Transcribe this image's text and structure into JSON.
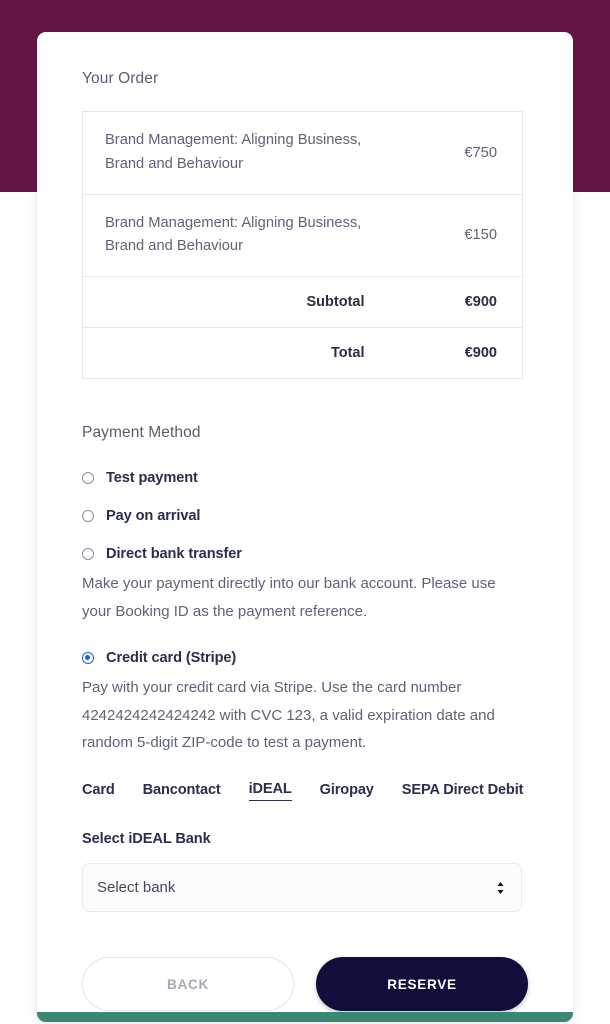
{
  "theme": {
    "page_top_band_color": "#661644",
    "card_accent_bar_color": "#3c8773",
    "selected_radio_color": "#1667cc",
    "primary_button_color": "#100f3c"
  },
  "card": {
    "order": {
      "heading": "Your Order",
      "items": [
        {
          "name": "Brand Management: Aligning Business, Brand and Behaviour",
          "price": "€750"
        },
        {
          "name": "Brand Management: Aligning Business, Brand and Behaviour",
          "price": "€150"
        }
      ],
      "summary": [
        {
          "label": "Subtotal",
          "value": "€900"
        },
        {
          "label": "Total",
          "value": "€900"
        }
      ]
    },
    "payment": {
      "heading": "Payment Method",
      "methods": [
        {
          "label": "Test payment",
          "selected": false,
          "description": null
        },
        {
          "label": "Pay on arrival",
          "selected": false,
          "description": null
        },
        {
          "label": "Direct bank transfer",
          "selected": false,
          "description": "Make your payment directly into our bank account. Please use your Booking ID as the payment reference."
        },
        {
          "label": "Credit card (Stripe)",
          "selected": true,
          "description": "Pay with your credit card via Stripe. Use the card number 4242424242424242 with CVC 123, a valid expiration date and random 5-digit ZIP-code to test a payment."
        }
      ],
      "stripe_tabs": [
        {
          "label": "Card",
          "active": false
        },
        {
          "label": "Bancontact",
          "active": false
        },
        {
          "label": "iDEAL",
          "active": true
        },
        {
          "label": "Giropay",
          "active": false
        },
        {
          "label": "SEPA Direct Debit",
          "active": false
        }
      ],
      "bank_select": {
        "label": "Select iDEAL Bank",
        "value": "Select bank",
        "icon": "chevron-up-down-icon"
      }
    },
    "actions": {
      "back_label": "BACK",
      "reserve_label": "RESERVE"
    }
  }
}
